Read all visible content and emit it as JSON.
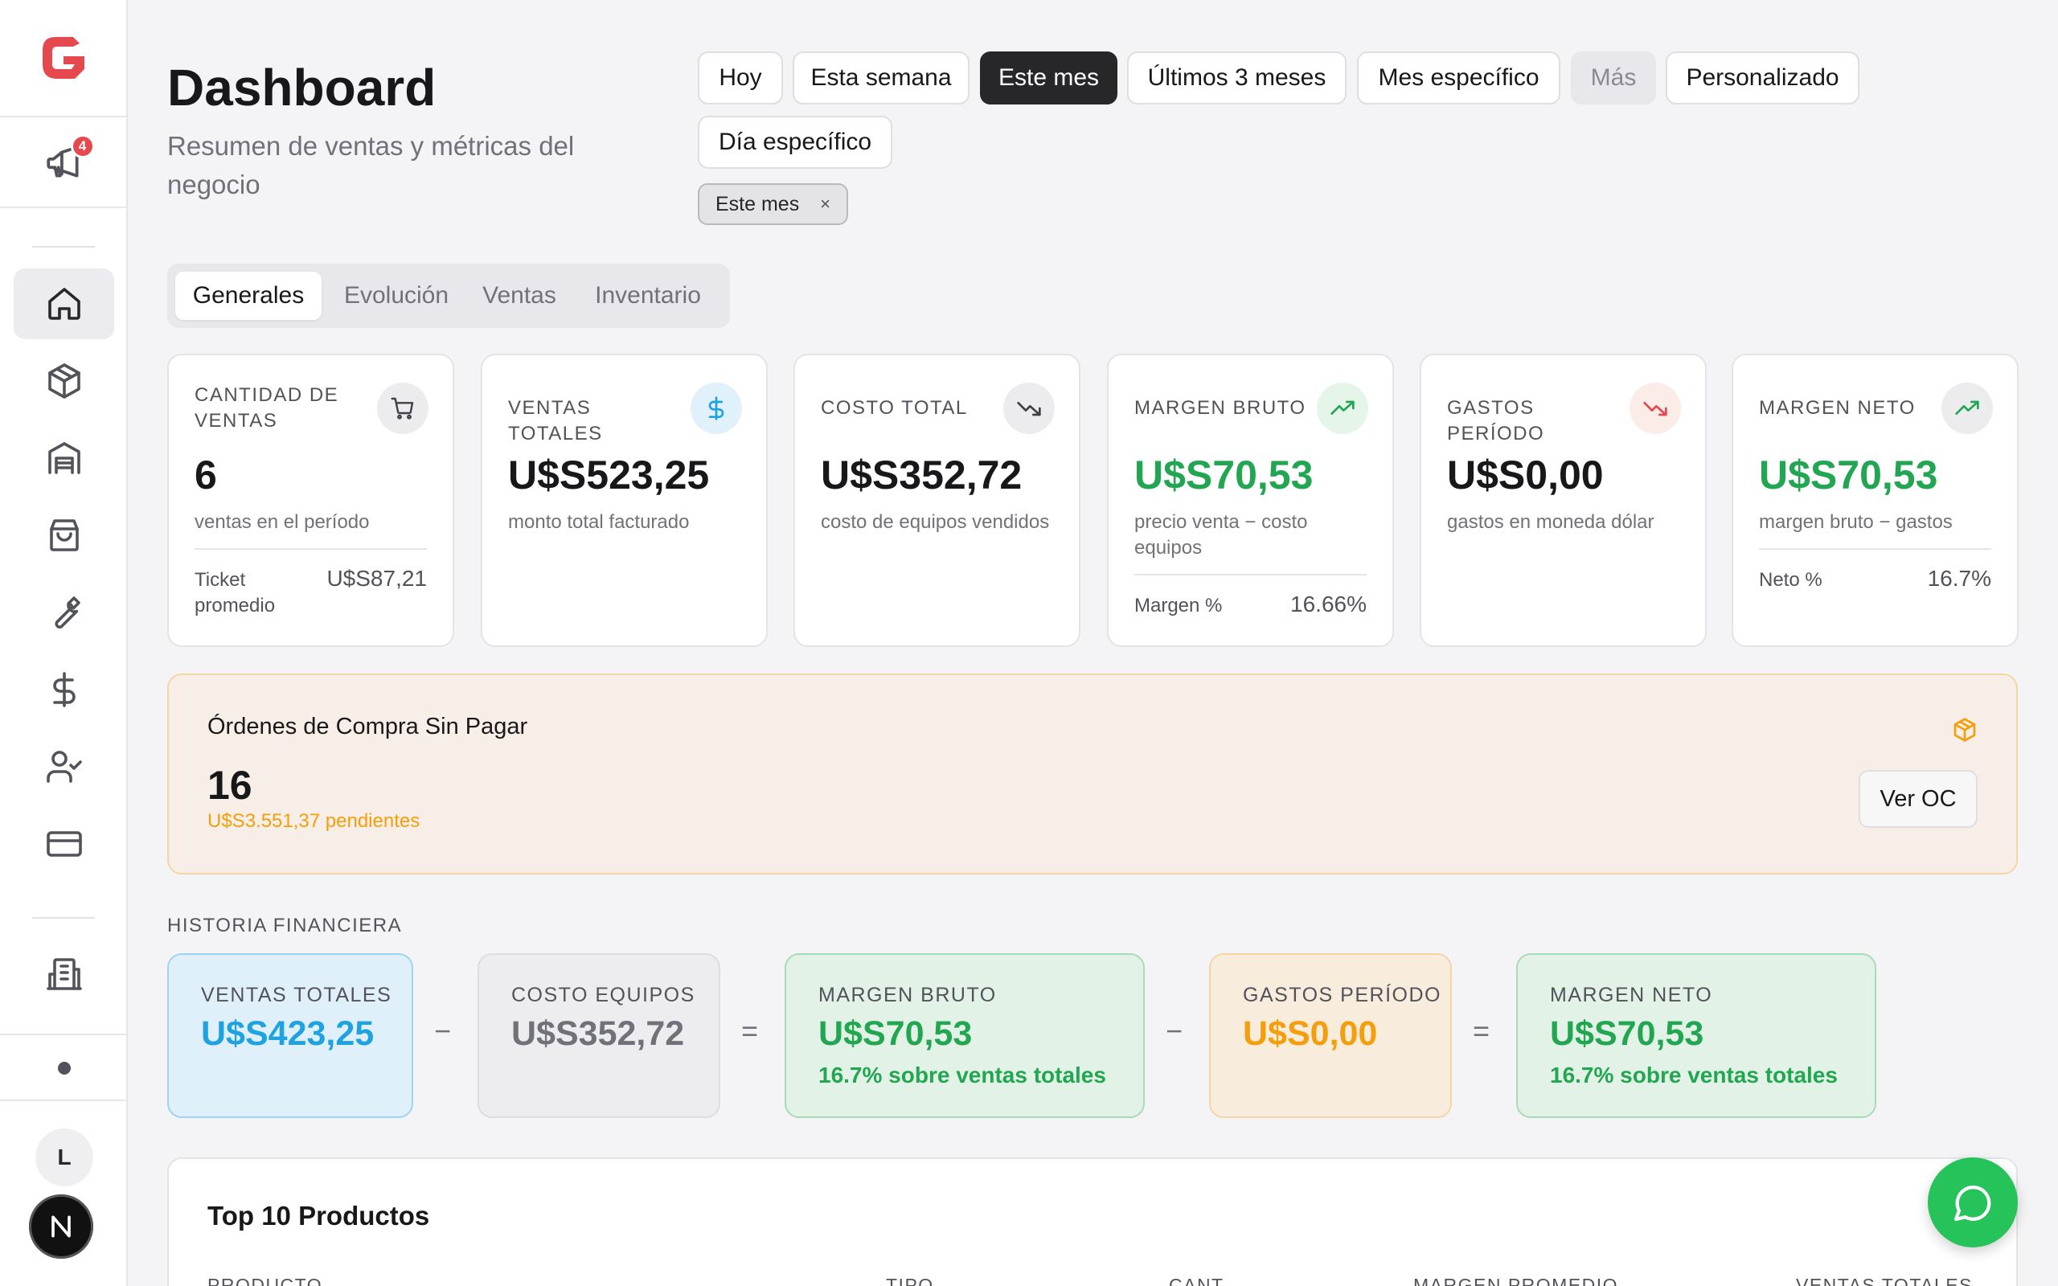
{
  "sidebar": {
    "announcement_badge": "4",
    "user_initial": "L",
    "bottom_badge": "N"
  },
  "header": {
    "title": "Dashboard",
    "subtitle": "Resumen de ventas y métricas del negocio"
  },
  "filters": {
    "buttons": [
      "Hoy",
      "Esta semana",
      "Este mes",
      "Últimos 3 meses",
      "Mes específico",
      "Más",
      "Personalizado",
      "Día específico"
    ],
    "active": "Este mes",
    "chip_label": "Este mes",
    "chip_close": "×"
  },
  "tabs": [
    "Generales",
    "Evolución",
    "Ventas",
    "Inventario"
  ],
  "kpis": [
    {
      "label": "CANTIDAD DE VENTAS",
      "value": "6",
      "desc": "ventas en el período",
      "foot_label": "Ticket promedio",
      "foot_value": "U$S87,21",
      "icon": "cart-icon"
    },
    {
      "label": "VENTAS TOTALES",
      "value": "U$S523,25",
      "desc": "monto total facturado",
      "icon": "dollar-icon"
    },
    {
      "label": "COSTO TOTAL",
      "value": "U$S352,72",
      "desc": "costo de equipos vendidos",
      "icon": "trending-down-icon"
    },
    {
      "label": "MARGEN BRUTO",
      "value": "U$S70,53",
      "desc": "precio venta − costo equipos",
      "foot_label": "Margen %",
      "foot_value": "16.66%",
      "icon": "trending-up-icon"
    },
    {
      "label": "GASTOS PERÍODO",
      "value": "U$S0,00",
      "desc": "gastos en moneda dólar",
      "icon": "trending-down-red-icon"
    },
    {
      "label": "MARGEN NETO",
      "value": "U$S70,53",
      "desc": "margen bruto − gastos",
      "foot_label": "Neto %",
      "foot_value": "16.7%",
      "icon": "trending-up-icon"
    }
  ],
  "orders": {
    "title": "Órdenes de Compra Sin Pagar",
    "count": "16",
    "pending": "U$S3.551,37 pendientes",
    "button": "Ver OC"
  },
  "history": {
    "title": "HISTORIA FINANCIERA",
    "boxes": [
      {
        "label": "VENTAS TOTALES",
        "value": "U$S423,25",
        "sub": ""
      },
      {
        "label": "COSTO EQUIPOS",
        "value": "U$S352,72",
        "sub": ""
      },
      {
        "label": "MARGEN BRUTO",
        "value": "U$S70,53",
        "sub": "16.7% sobre ventas totales"
      },
      {
        "label": "GASTOS PERÍODO",
        "value": "U$S0,00",
        "sub": ""
      },
      {
        "label": "MARGEN NETO",
        "value": "U$S70,53",
        "sub": "16.7% sobre ventas totales"
      }
    ],
    "operators": [
      "−",
      "=",
      "−",
      "="
    ]
  },
  "top10": {
    "title": "Top 10 Productos",
    "columns": [
      "PRODUCTO",
      "TIPO",
      "CANT.",
      "MARGEN PROMEDIO",
      "VENTAS TOTALES"
    ]
  },
  "colors": {
    "accent_dark": "#27272a",
    "green": "#22a652",
    "orange": "#f59e0b",
    "blue": "#1fa3e0",
    "logo_red": "#e5484d",
    "whatsapp": "#25c35a"
  }
}
